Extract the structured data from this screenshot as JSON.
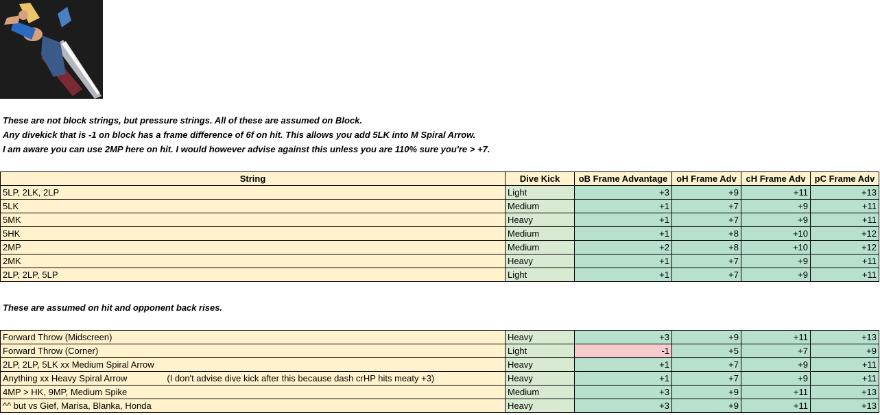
{
  "portrait": {
    "alt_icon": "character-art-icon"
  },
  "notes": [
    "These are not block strings, but pressure strings. All of these are assumed on Block.",
    "Any divekick that is -1 on block has a frame difference of 6f on hit. This allows you add 5LK into M Spiral Arrow.",
    "I am aware you can use 2MP here on hit. I would however advise against this unless you are 110% sure you're > +7."
  ],
  "table_headers": [
    "String",
    "Dive Kick",
    "oB Frame Advantage",
    "oH Frame Adv",
    "cH Frame Adv",
    "pC Frame Adv"
  ],
  "block_rows": [
    {
      "string": "5LP, 2LK, 2LP",
      "dive": "Light",
      "ob": "+3",
      "oh": "+9",
      "ch": "+11",
      "pc": "+13"
    },
    {
      "string": "5LK",
      "dive": "Medium",
      "ob": "+1",
      "oh": "+7",
      "ch": "+9",
      "pc": "+11"
    },
    {
      "string": "5MK",
      "dive": "Heavy",
      "ob": "+1",
      "oh": "+7",
      "ch": "+9",
      "pc": "+11"
    },
    {
      "string": "5HK",
      "dive": "Medium",
      "ob": "+1",
      "oh": "+8",
      "ch": "+10",
      "pc": "+12"
    },
    {
      "string": "2MP",
      "dive": "Medium",
      "ob": "+2",
      "oh": "+8",
      "ch": "+10",
      "pc": "+12"
    },
    {
      "string": "2MK",
      "dive": "Heavy",
      "ob": "+1",
      "oh": "+7",
      "ch": "+9",
      "pc": "+11"
    },
    {
      "string": "2LP, 2LP, 5LP",
      "dive": "Light",
      "ob": "+1",
      "oh": "+7",
      "ch": "+9",
      "pc": "+11"
    }
  ],
  "hit_note": "These are assumed on hit and opponent back rises.",
  "hit_rows": [
    {
      "string": "Forward Throw (Midscreen)",
      "extra": "",
      "dive": "Heavy",
      "ob": "+3",
      "oh": "+9",
      "ch": "+11",
      "pc": "+13",
      "negative": false
    },
    {
      "string": "Forward Throw (Corner)",
      "extra": "",
      "dive": "Light",
      "ob": "-1",
      "oh": "+5",
      "ch": "+7",
      "pc": "+9",
      "negative": true
    },
    {
      "string": "2LP, 2LP, 5LK xx Medium Spiral Arrow",
      "extra": "",
      "dive": "Heavy",
      "ob": "+1",
      "oh": "+7",
      "ch": "+9",
      "pc": "+11",
      "negative": false
    },
    {
      "string": "Anything xx Heavy Spiral Arrow",
      "extra": "(I don't advise dive kick after this because dash crHP hits meaty +3)",
      "dive": "Heavy",
      "ob": "+1",
      "oh": "+7",
      "ch": "+9",
      "pc": "+11",
      "negative": false
    },
    {
      "string": "4MP > HK, 9MP, Medium Spike",
      "extra": "",
      "dive": "Medium",
      "ob": "+3",
      "oh": "+9",
      "ch": "+11",
      "pc": "+13",
      "negative": false
    },
    {
      "string": "^^ but vs Gief, Marisa, Blanka, Honda",
      "extra": "",
      "dive": "Heavy",
      "ob": "+3",
      "oh": "+9",
      "ch": "+11",
      "pc": "+13",
      "negative": false
    }
  ]
}
